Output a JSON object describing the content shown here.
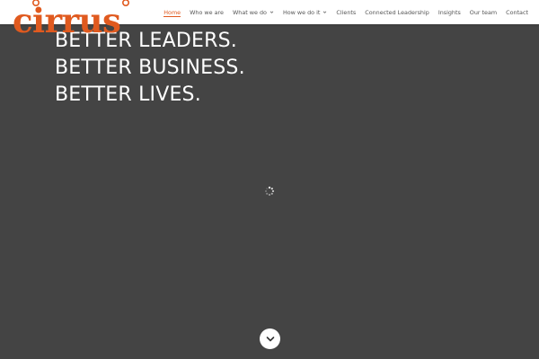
{
  "brand": {
    "logo_text": "cirrus",
    "accent_color": "#e05a1f"
  },
  "nav": {
    "items": [
      {
        "label": "Home",
        "active": true,
        "dropdown": false
      },
      {
        "label": "Who we are",
        "active": false,
        "dropdown": false
      },
      {
        "label": "What we do",
        "active": false,
        "dropdown": true
      },
      {
        "label": "How we do it",
        "active": false,
        "dropdown": true
      },
      {
        "label": "Clients",
        "active": false,
        "dropdown": false
      },
      {
        "label": "Connected Leadership",
        "active": false,
        "dropdown": false
      },
      {
        "label": "Insights",
        "active": false,
        "dropdown": false
      },
      {
        "label": "Our team",
        "active": false,
        "dropdown": false
      },
      {
        "label": "Contact",
        "active": false,
        "dropdown": false
      }
    ]
  },
  "hero": {
    "line1": "BETTER LEADERS.",
    "line2": "BETTER BUSINESS.",
    "line3": "BETTER LIVES.",
    "background_color": "#444444"
  },
  "icons": {
    "loading": "loading-spinner-icon",
    "scroll_down": "chevron-down-icon"
  }
}
